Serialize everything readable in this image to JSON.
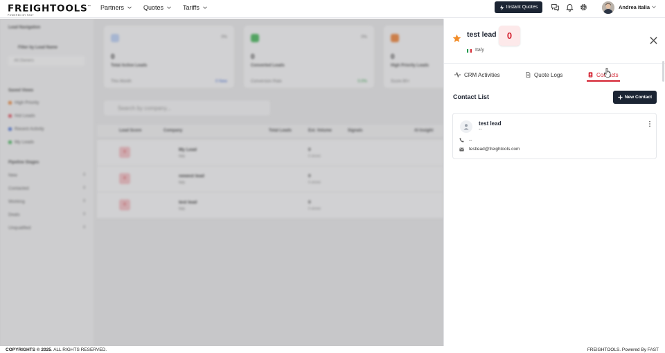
{
  "brand": {
    "name": "FREIGHTOOLS",
    "tm": "™",
    "tagline": "POWERED BY FAST"
  },
  "nav": {
    "items": [
      {
        "label": "Partners"
      },
      {
        "label": "Quotes"
      },
      {
        "label": "Tariffs"
      }
    ],
    "instant_quotes": "Instant Quotes",
    "user_name": "Andrea Italia"
  },
  "background": {
    "sidebar": {
      "title": "Lead Navigation",
      "filter": "Filter by Lead Name",
      "all_owners": "All Owners",
      "views_title": "Saved Views",
      "views": [
        "High Priority",
        "Hot Leads",
        "Recent Activity",
        "My Leads"
      ],
      "pipeline_title": "Pipeline Stages",
      "stages": [
        {
          "label": "New",
          "count": "0"
        },
        {
          "label": "Contacted",
          "count": "0"
        },
        {
          "label": "Working",
          "count": "0"
        },
        {
          "label": "Deals",
          "count": "0"
        },
        {
          "label": "Unqualified",
          "count": "0"
        }
      ]
    },
    "cards": [
      {
        "value": "0",
        "label": "Total Active Leads",
        "foot": "This Month",
        "right": "0 New",
        "pct": "0%"
      },
      {
        "value": "0",
        "label": "Converted Leads",
        "foot": "Conversion Rate",
        "right": "0.0%",
        "pct": "0%"
      },
      {
        "value": "0",
        "label": "High Priority Leads",
        "foot": "Score 80+",
        "right": "",
        "pct": ""
      }
    ],
    "search_placeholder": "Search by company...",
    "table_headers": [
      "Lead Score",
      "Company",
      "Total Leads",
      "Est. Volume",
      "Signals",
      "AI Insight"
    ],
    "rows": [
      {
        "score": "0",
        "name": "My Lead",
        "sub": "Italy",
        "volume": "0",
        "volume_sub": "0 shmnt"
      },
      {
        "score": "0",
        "name": "newest lead",
        "sub": "Italy",
        "volume": "0",
        "volume_sub": "0 shmnt"
      },
      {
        "score": "0",
        "name": "test lead",
        "sub": "Italy",
        "volume": "0",
        "volume_sub": "0 shmnt"
      }
    ]
  },
  "drawer": {
    "lead_name": "test lead",
    "score": "0",
    "country": "Italy",
    "tabs": [
      {
        "label": "CRM Activities",
        "active": false
      },
      {
        "label": "Quote Logs",
        "active": false
      },
      {
        "label": "Contacts",
        "active": true
      }
    ],
    "section_title": "Contact List",
    "new_contact_label": "New Contact",
    "contact": {
      "name": "test lead",
      "role": "--",
      "phone": "--",
      "email": "testlead@freightools.com"
    }
  },
  "footer": {
    "copyright_bold": "COPYRIGHTS © 2025",
    "copyright_rest": ". ALL RIGHTS RESERVED.",
    "powered": "FREIGHTOOLS. Powered By FAST"
  },
  "colors": {
    "accent": "#d4202f",
    "dark_button": "#1b2433",
    "star": "#f28c28"
  },
  "icons": [
    "chevron-down-icon",
    "bolt-icon",
    "chat-icon",
    "bell-icon",
    "gear-icon",
    "star-icon",
    "close-icon",
    "activity-icon",
    "document-icon",
    "contacts-icon",
    "plus-icon",
    "user-icon",
    "kebab-menu-icon",
    "phone-icon",
    "email-icon"
  ]
}
